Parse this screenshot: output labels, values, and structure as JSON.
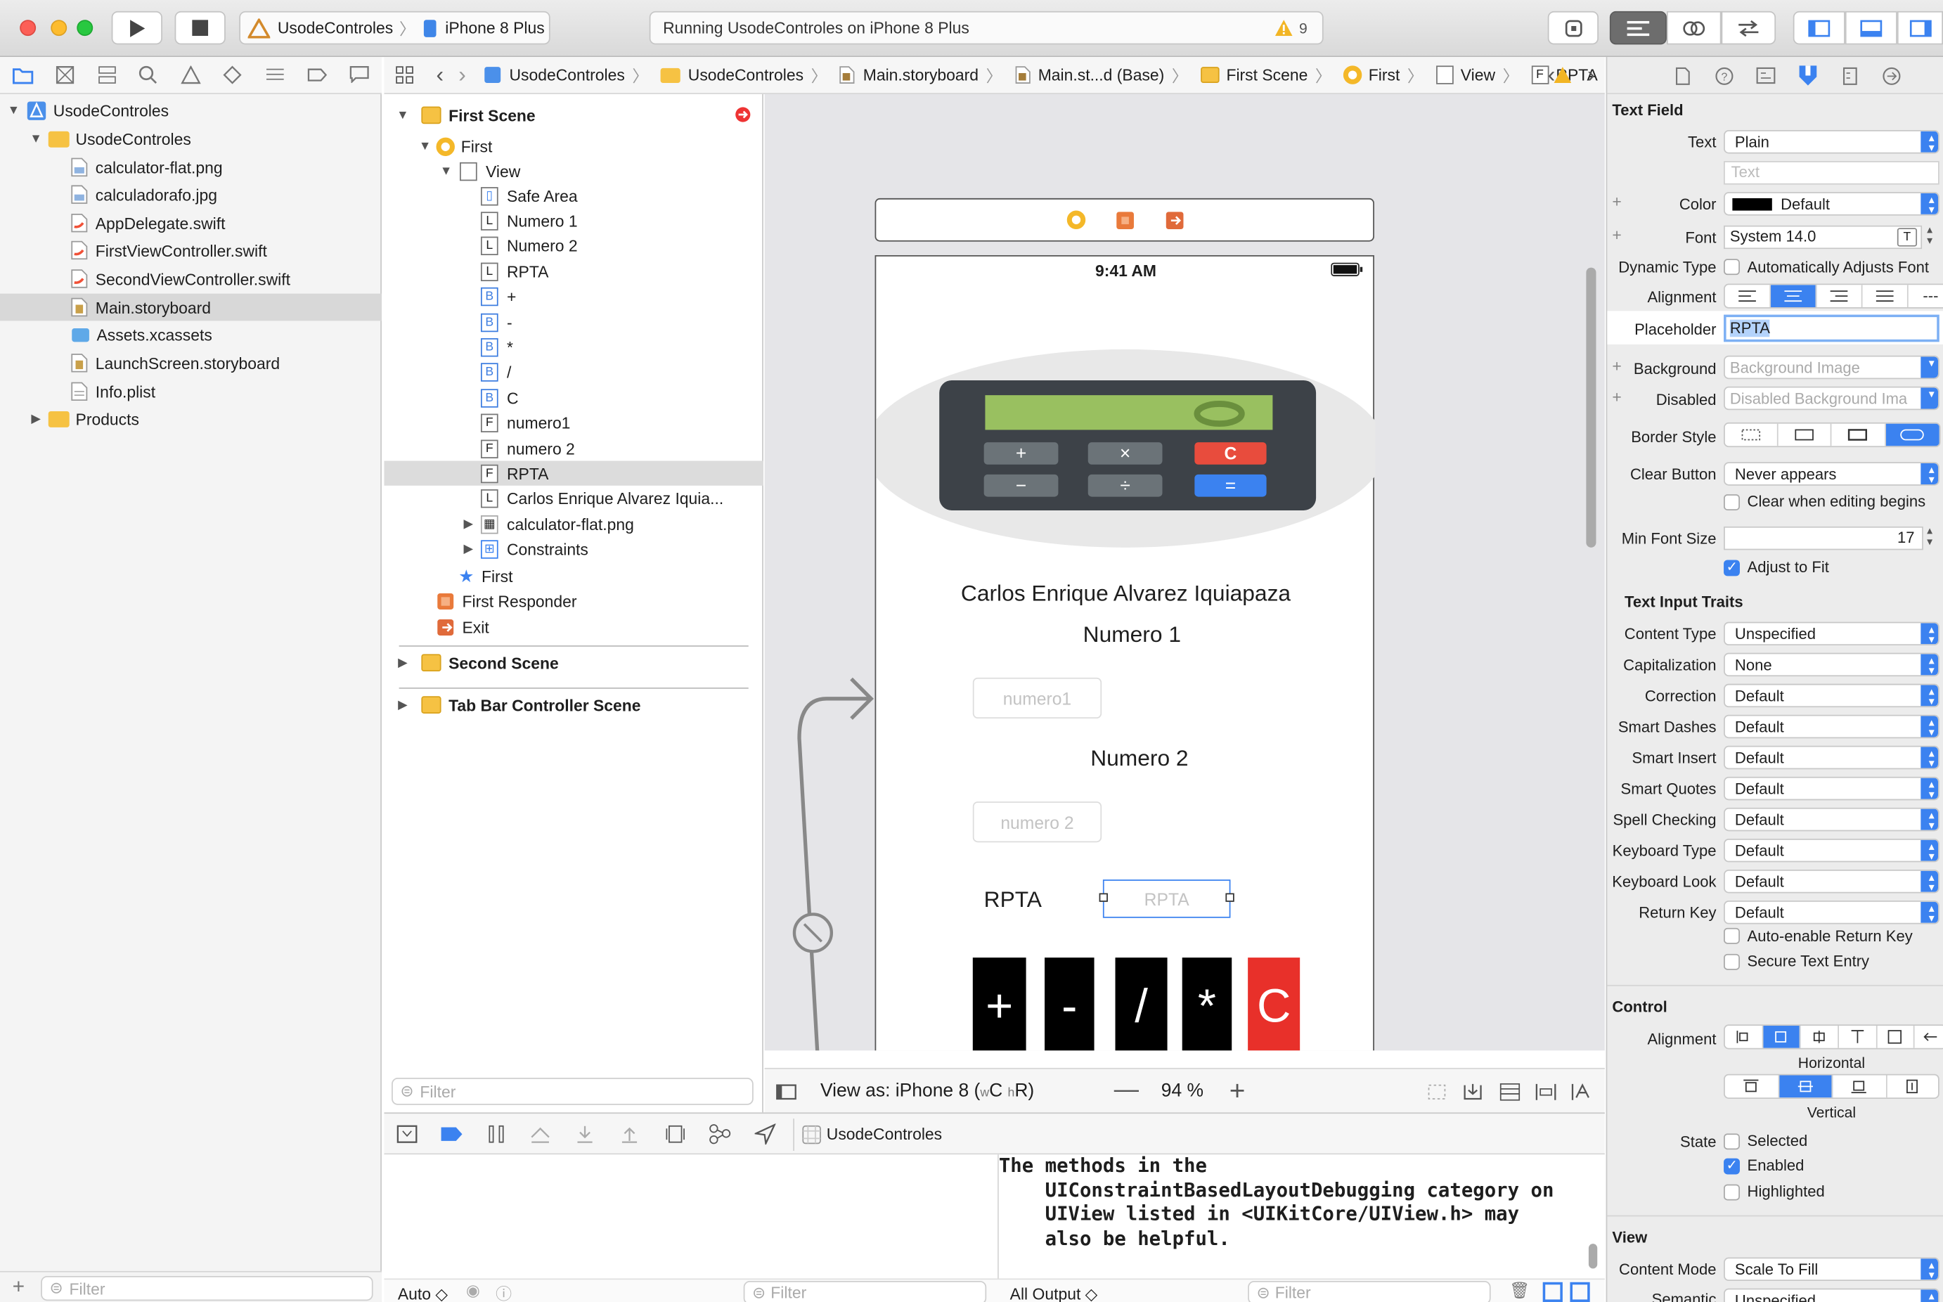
{
  "toolbar": {
    "scheme_app": "UsodeControles",
    "scheme_device": "iPhone 8 Plus",
    "activity": "Running UsodeControles on iPhone 8 Plus",
    "warning_count": "9"
  },
  "navigator": {
    "items": [
      {
        "label": "UsodeControles",
        "depth": 0,
        "kind": "project"
      },
      {
        "label": "UsodeControles",
        "depth": 1,
        "kind": "folder"
      },
      {
        "label": "calculator-flat.png",
        "depth": 2,
        "kind": "image"
      },
      {
        "label": "calculadorafo.jpg",
        "depth": 2,
        "kind": "image"
      },
      {
        "label": "AppDelegate.swift",
        "depth": 2,
        "kind": "swift"
      },
      {
        "label": "FirstViewController.swift",
        "depth": 2,
        "kind": "swift"
      },
      {
        "label": "SecondViewController.swift",
        "depth": 2,
        "kind": "swift"
      },
      {
        "label": "Main.storyboard",
        "depth": 2,
        "kind": "storyboard"
      },
      {
        "label": "Assets.xcassets",
        "depth": 2,
        "kind": "assets"
      },
      {
        "label": "LaunchScreen.storyboard",
        "depth": 2,
        "kind": "storyboard"
      },
      {
        "label": "Info.plist",
        "depth": 2,
        "kind": "plist"
      },
      {
        "label": "Products",
        "depth": 1,
        "kind": "folder"
      }
    ],
    "filter_placeholder": "Filter"
  },
  "jumpbar": [
    "UsodeControles",
    "UsodeControles",
    "Main.storyboard",
    "Main.st...d (Base)",
    "First Scene",
    "First",
    "View",
    "RPTA"
  ],
  "outline": {
    "first_scene": "First Scene",
    "first": "First",
    "view": "View",
    "children": [
      {
        "badge": "",
        "label": "Safe Area"
      },
      {
        "badge": "L",
        "label": "Numero 1"
      },
      {
        "badge": "L",
        "label": "Numero 2"
      },
      {
        "badge": "L",
        "label": "RPTA"
      },
      {
        "badge": "B",
        "label": "+"
      },
      {
        "badge": "B",
        "label": "-"
      },
      {
        "badge": "B",
        "label": "*"
      },
      {
        "badge": "B",
        "label": "/"
      },
      {
        "badge": "B",
        "label": "C"
      },
      {
        "badge": "F",
        "label": "numero1"
      },
      {
        "badge": "F",
        "label": "numero 2"
      },
      {
        "badge": "F",
        "label": "RPTA"
      },
      {
        "badge": "L",
        "label": "Carlos Enrique Alvarez Iquia..."
      },
      {
        "badge": "",
        "label": "calculator-flat.png"
      },
      {
        "badge": "",
        "label": "Constraints"
      }
    ],
    "first_vc": "First",
    "first_responder": "First Responder",
    "exit": "Exit",
    "second_scene": "Second Scene",
    "tabbar_scene": "Tab Bar Controller Scene",
    "filter_placeholder": "Filter"
  },
  "device": {
    "time": "9:41 AM",
    "author": "Carlos Enrique Alvarez Iquiapaza",
    "numero1_label": "Numero 1",
    "numero1_placeholder": "numero1",
    "numero2_label": "Numero 2",
    "numero2_placeholder": "numero 2",
    "rpta_label": "RPTA",
    "rpta_placeholder": "RPTA",
    "buttons": [
      "+",
      "-",
      "/",
      "*",
      "C"
    ]
  },
  "canvas_bar": {
    "view_as": "View as: iPhone 8 (",
    "wc": "w",
    "c": "C ",
    "hr": "h",
    "r": "R)",
    "zoom": "94 %"
  },
  "debug": {
    "target": "UsodeControles",
    "console": "The methods in the\n    UIConstraintBasedLayoutDebugging category on\n    UIView listed in <UIKitCore/UIView.h> may\n    also be helpful.",
    "auto": "Auto ◇",
    "output": "All Output ◇",
    "filter": "Filter"
  },
  "inspector": {
    "title": "Text Field",
    "text_label": "Text",
    "text_value": "Plain",
    "text_placeholder": "Text",
    "color_label": "Color",
    "color_value": "Default",
    "font_label": "Font",
    "font_value": "System 14.0",
    "dynamic_type_label": "Dynamic Type",
    "dynamic_type_value": "Automatically Adjusts Font",
    "alignment_label": "Alignment",
    "placeholder_label": "Placeholder",
    "placeholder_value": "RPTA",
    "background_label": "Background",
    "background_value": "Background Image",
    "disabled_label": "Disabled",
    "disabled_value": "Disabled Background Ima",
    "border_label": "Border Style",
    "clear_button_label": "Clear Button",
    "clear_button_value": "Never appears",
    "clear_editing": "Clear when editing begins",
    "min_font_label": "Min Font Size",
    "min_font_value": "17",
    "adjust_to_fit": "Adjust to Fit",
    "traits_title": "Text Input Traits",
    "traits": [
      {
        "label": "Content Type",
        "value": "Unspecified"
      },
      {
        "label": "Capitalization",
        "value": "None"
      },
      {
        "label": "Correction",
        "value": "Default"
      },
      {
        "label": "Smart Dashes",
        "value": "Default"
      },
      {
        "label": "Smart Insert",
        "value": "Default"
      },
      {
        "label": "Smart Quotes",
        "value": "Default"
      },
      {
        "label": "Spell Checking",
        "value": "Default"
      },
      {
        "label": "Keyboard Type",
        "value": "Default"
      },
      {
        "label": "Keyboard Look",
        "value": "Default"
      },
      {
        "label": "Return Key",
        "value": "Default"
      }
    ],
    "auto_return": "Auto-enable Return Key",
    "secure": "Secure Text Entry",
    "control_title": "Control",
    "control_alignment_label": "Alignment",
    "horizontal": "Horizontal",
    "vertical": "Vertical",
    "state_label": "State",
    "selected": "Selected",
    "enabled": "Enabled",
    "highlighted": "Highlighted",
    "view_title": "View",
    "content_mode_label": "Content Mode",
    "content_mode_value": "Scale To Fill",
    "semantic_label": "Semantic",
    "semantic_value": "Unspecified"
  }
}
